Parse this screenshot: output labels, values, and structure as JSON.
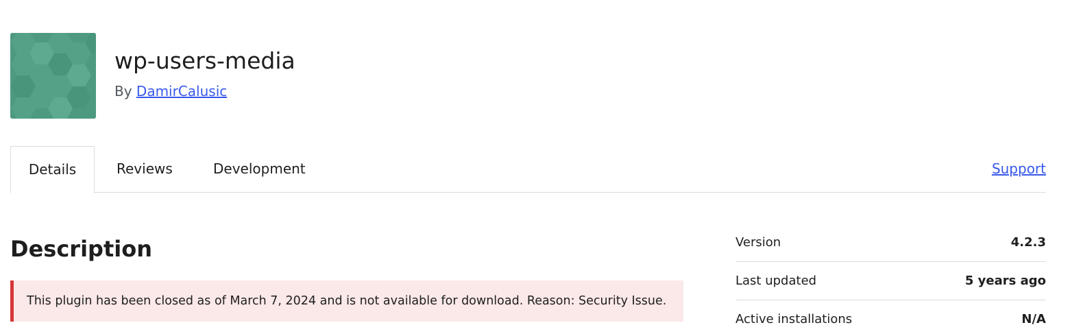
{
  "plugin": {
    "name": "wp-users-media",
    "by_prefix": "By",
    "author": "DamirCalusic",
    "icon": "hexagon-pattern-plugin-icon",
    "icon_color": "#4e9a81"
  },
  "tabs": {
    "details": "Details",
    "reviews": "Reviews",
    "development": "Development",
    "support": "Support"
  },
  "description": {
    "title": "Description",
    "notice": "This plugin has been closed as of March 7, 2024 and is not available for download. Reason: Security Issue.",
    "notice_border_color": "#d63638",
    "notice_bg_color": "#fbe8e8"
  },
  "meta": {
    "version_label": "Version",
    "version_value": "4.2.3",
    "updated_label": "Last updated",
    "updated_value": "5 years ago",
    "installs_label": "Active installations",
    "installs_value": "N/A"
  },
  "colors": {
    "link": "#3858e9",
    "text": "#1e1e1e"
  }
}
